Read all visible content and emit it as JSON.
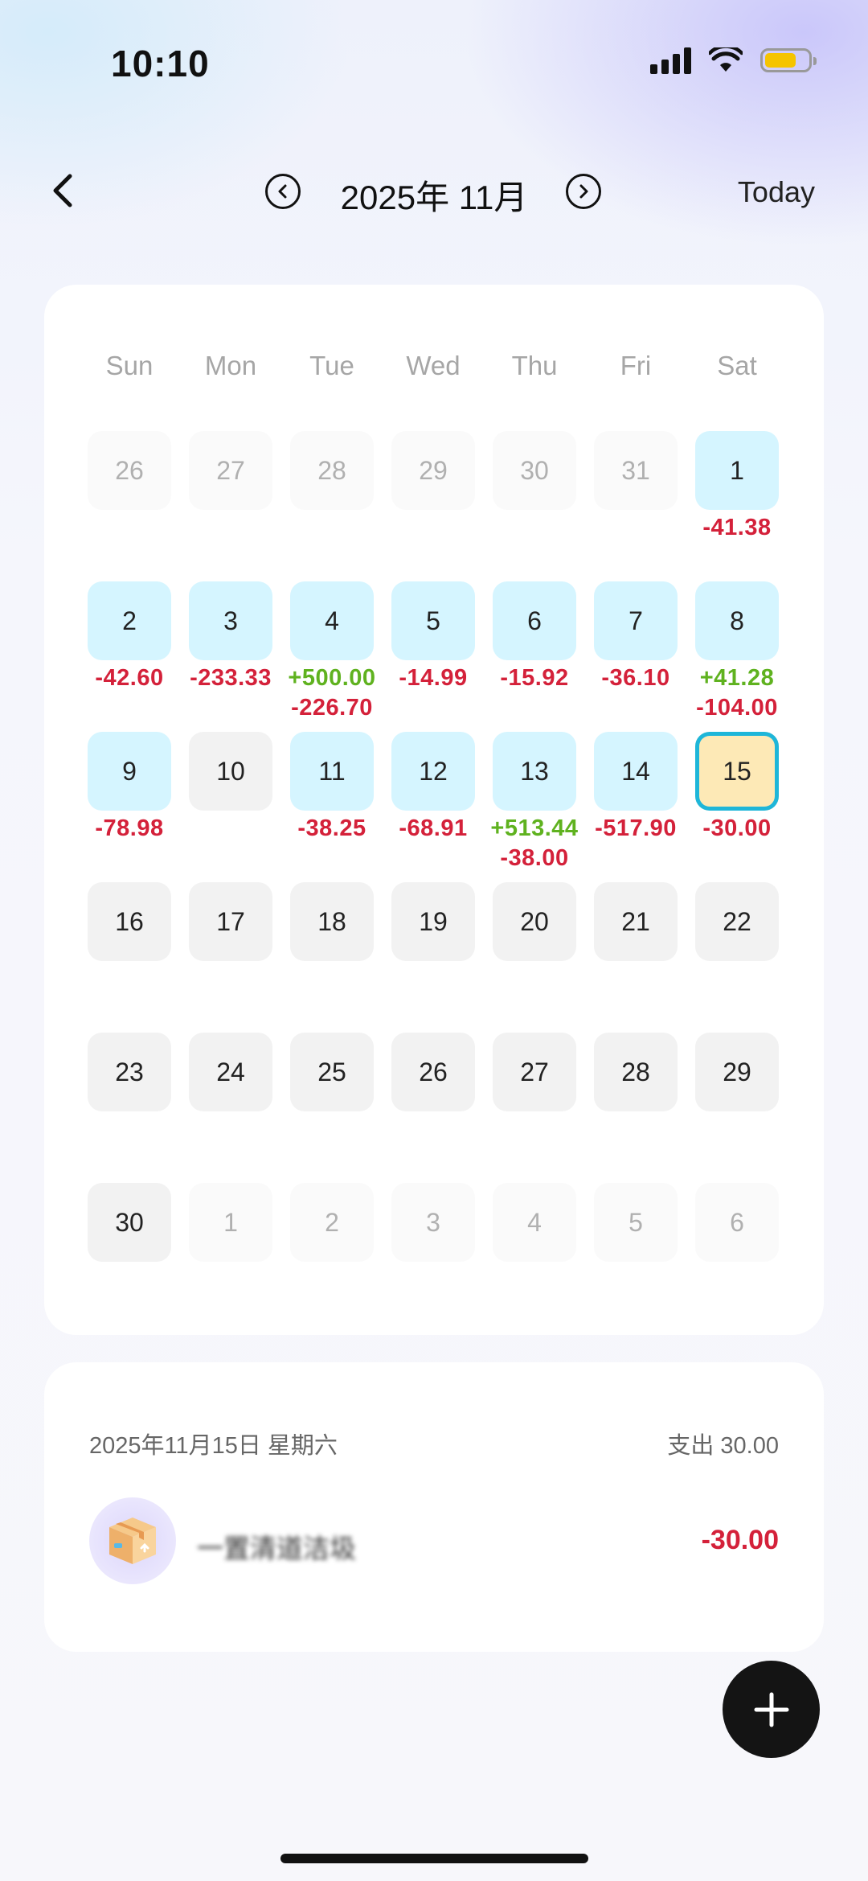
{
  "status_bar": {
    "time": "10:10"
  },
  "header": {
    "month_title": "2025年 11月",
    "today_label": "Today"
  },
  "calendar": {
    "weekdays": [
      "Sun",
      "Mon",
      "Tue",
      "Wed",
      "Thu",
      "Fri",
      "Sat"
    ],
    "selected_day": "15",
    "weeks": [
      [
        {
          "day": "26",
          "state": "other"
        },
        {
          "day": "27",
          "state": "other"
        },
        {
          "day": "28",
          "state": "other"
        },
        {
          "day": "29",
          "state": "other"
        },
        {
          "day": "30",
          "state": "other"
        },
        {
          "day": "31",
          "state": "other"
        },
        {
          "day": "1",
          "state": "rec",
          "amounts": [
            {
              "text": "-41.38",
              "type": "neg"
            }
          ]
        }
      ],
      [
        {
          "day": "2",
          "state": "rec",
          "amounts": [
            {
              "text": "-42.60",
              "type": "neg"
            }
          ]
        },
        {
          "day": "3",
          "state": "rec",
          "amounts": [
            {
              "text": "-233.33",
              "type": "neg"
            }
          ]
        },
        {
          "day": "4",
          "state": "rec",
          "amounts": [
            {
              "text": "+500.00",
              "type": "pos"
            },
            {
              "text": "-226.70",
              "type": "neg"
            }
          ]
        },
        {
          "day": "5",
          "state": "rec",
          "amounts": [
            {
              "text": "-14.99",
              "type": "neg"
            }
          ]
        },
        {
          "day": "6",
          "state": "rec",
          "amounts": [
            {
              "text": "-15.92",
              "type": "neg"
            }
          ]
        },
        {
          "day": "7",
          "state": "rec",
          "amounts": [
            {
              "text": "-36.10",
              "type": "neg"
            }
          ]
        },
        {
          "day": "8",
          "state": "rec",
          "amounts": [
            {
              "text": "+41.28",
              "type": "pos"
            },
            {
              "text": "-104.00",
              "type": "neg"
            }
          ]
        }
      ],
      [
        {
          "day": "9",
          "state": "rec",
          "amounts": [
            {
              "text": "-78.98",
              "type": "neg"
            }
          ]
        },
        {
          "day": "10",
          "state": "norm"
        },
        {
          "day": "11",
          "state": "rec",
          "amounts": [
            {
              "text": "-38.25",
              "type": "neg"
            }
          ]
        },
        {
          "day": "12",
          "state": "rec",
          "amounts": [
            {
              "text": "-68.91",
              "type": "neg"
            }
          ]
        },
        {
          "day": "13",
          "state": "rec",
          "amounts": [
            {
              "text": "+513.44",
              "type": "pos"
            },
            {
              "text": "-38.00",
              "type": "neg"
            }
          ]
        },
        {
          "day": "14",
          "state": "rec",
          "amounts": [
            {
              "text": "-517.90",
              "type": "neg"
            }
          ]
        },
        {
          "day": "15",
          "state": "sel",
          "amounts": [
            {
              "text": "-30.00",
              "type": "neg"
            }
          ]
        }
      ],
      [
        {
          "day": "16",
          "state": "norm"
        },
        {
          "day": "17",
          "state": "norm"
        },
        {
          "day": "18",
          "state": "norm"
        },
        {
          "day": "19",
          "state": "norm"
        },
        {
          "day": "20",
          "state": "norm"
        },
        {
          "day": "21",
          "state": "norm"
        },
        {
          "day": "22",
          "state": "norm"
        }
      ],
      [
        {
          "day": "23",
          "state": "norm"
        },
        {
          "day": "24",
          "state": "norm"
        },
        {
          "day": "25",
          "state": "norm"
        },
        {
          "day": "26",
          "state": "norm"
        },
        {
          "day": "27",
          "state": "norm"
        },
        {
          "day": "28",
          "state": "norm"
        },
        {
          "day": "29",
          "state": "norm"
        }
      ],
      [
        {
          "day": "30",
          "state": "norm"
        },
        {
          "day": "1",
          "state": "other"
        },
        {
          "day": "2",
          "state": "other"
        },
        {
          "day": "3",
          "state": "other"
        },
        {
          "day": "4",
          "state": "other"
        },
        {
          "day": "5",
          "state": "other"
        },
        {
          "day": "6",
          "state": "other"
        }
      ]
    ]
  },
  "detail": {
    "date_label": "2025年11月15日 星期六",
    "summary_label": "支出 30.00",
    "transaction": {
      "icon": "package-box-icon",
      "name": "一置清道洁圾",
      "amount": "-30.00"
    }
  },
  "colors": {
    "record_day_bg": "#d5f5ff",
    "selected_day_bg": "#fde9b6",
    "selected_border": "#1eb6d9",
    "expense": "#d4213a",
    "income": "#5fb21f",
    "fab_bg": "#141414"
  }
}
